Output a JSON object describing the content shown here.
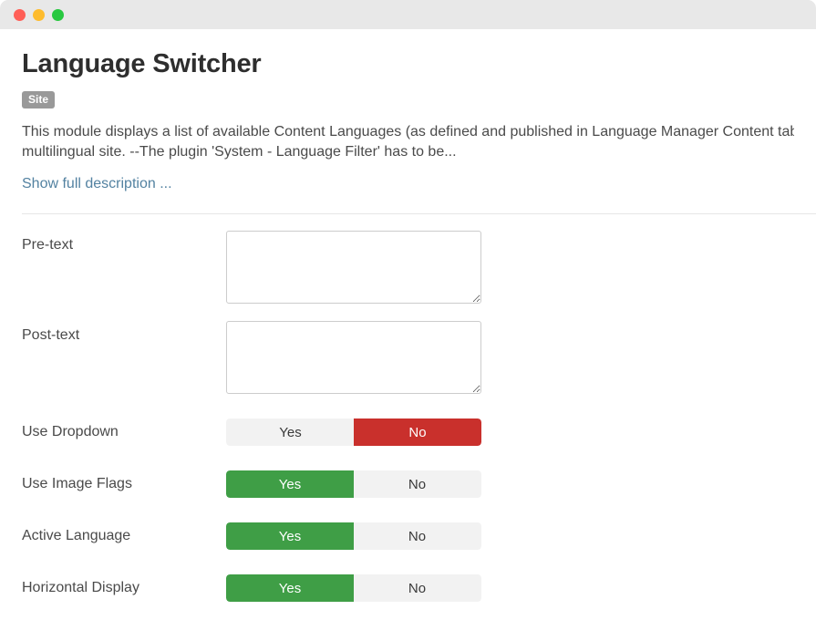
{
  "window": {
    "traffic_lights": [
      {
        "name": "close",
        "color": "#ff5f57"
      },
      {
        "name": "minimize",
        "color": "#febc2e"
      },
      {
        "name": "maximize",
        "color": "#28c840"
      }
    ]
  },
  "header": {
    "title": "Language Switcher",
    "badge": "Site",
    "description_line1": "This module displays a list of available Content Languages (as defined and published in Language Manager Content tab)",
    "description_line2": "multilingual site. --The plugin 'System - Language Filter' has to be...",
    "show_full_link": "Show full description ..."
  },
  "form": {
    "textareas": [
      {
        "label": "Pre-text",
        "value": "",
        "placeholder": ""
      },
      {
        "label": "Post-text",
        "value": "",
        "placeholder": ""
      }
    ],
    "toggles": [
      {
        "label": "Use Dropdown",
        "yes_label": "Yes",
        "no_label": "No",
        "selected": "No"
      },
      {
        "label": "Use Image Flags",
        "yes_label": "Yes",
        "no_label": "No",
        "selected": "Yes"
      },
      {
        "label": "Active Language",
        "yes_label": "Yes",
        "no_label": "No",
        "selected": "Yes"
      },
      {
        "label": "Horizontal Display",
        "yes_label": "Yes",
        "no_label": "No",
        "selected": "Yes"
      }
    ]
  },
  "colors": {
    "yes_active": "#3f9e46",
    "no_active": "#c9302c",
    "inactive": "#f2f2f2",
    "link": "#5382a1",
    "badge": "#999999",
    "titlebar": "#e8e8e8"
  }
}
